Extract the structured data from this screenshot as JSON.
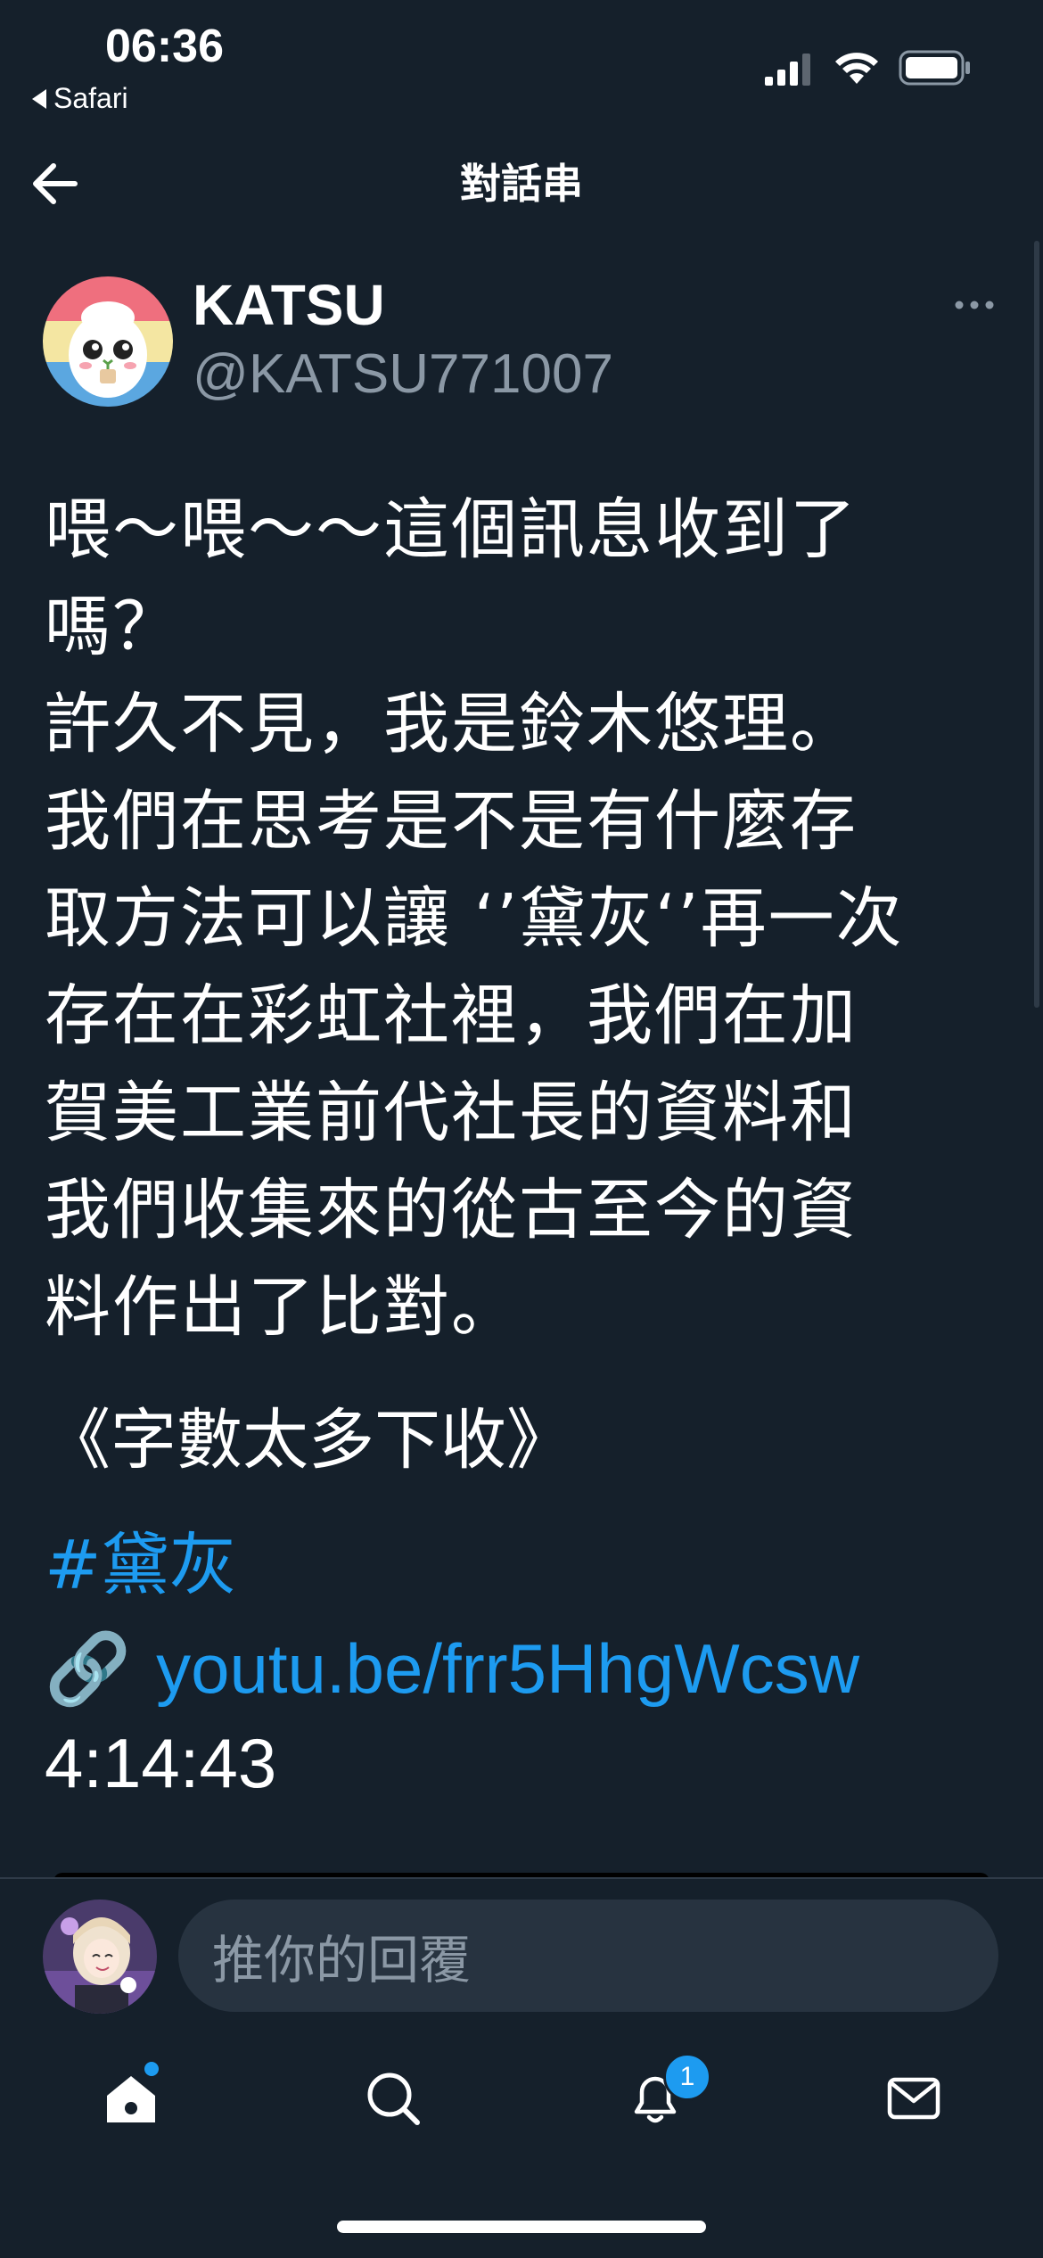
{
  "status_bar": {
    "time": "06:36",
    "back_app": "Safari",
    "signal_icon": "signal-icon",
    "wifi_icon": "wifi-icon",
    "battery_icon": "battery-icon"
  },
  "header": {
    "title": "對話串",
    "back_icon": "arrow-left-icon"
  },
  "tweet": {
    "display_name": "KATSU",
    "handle": "@KATSU771007",
    "more_icon": "more-horizontal-icon",
    "body": "喂～喂～～這個訊息收到了\n嗎？\n許久不見，我是鈴木悠理。\n我們在思考是不是有什麼存\n取方法可以讓 ‘’黛灰‘’再一次\n存在在彩虹社裡，我們在加\n賀美工業前代社長的資料和\n我們收集來的從古至今的資\n料作出了比對。",
    "note": "《字數太多下收》",
    "hashtag": "#黛灰",
    "link_icon": "🔗",
    "link_text": "youtu.be/frr5HhgWcsw",
    "timecode": "4:14:43"
  },
  "reply": {
    "placeholder": "推你的回覆"
  },
  "tabbar": {
    "home_icon": "home-icon",
    "search_icon": "search-icon",
    "notifications_icon": "bell-icon",
    "notifications_badge": "1",
    "messages_icon": "mail-icon"
  },
  "colors": {
    "background": "#15202b",
    "accent": "#1d9bf0",
    "secondary_text": "#8b98a5",
    "input_bg": "#273340"
  }
}
